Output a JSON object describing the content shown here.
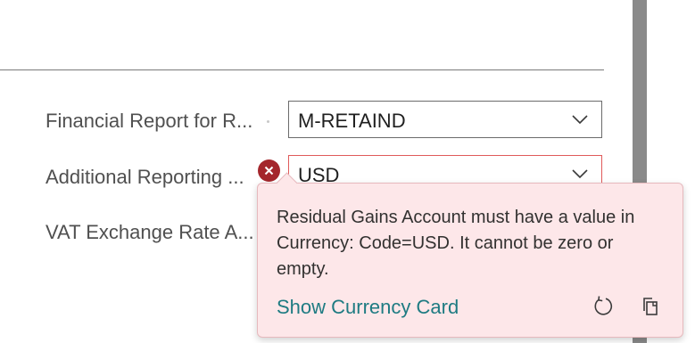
{
  "fields": [
    {
      "label": "Financial Report for R...",
      "value": "M-RETAIND",
      "has_error": false
    },
    {
      "label": "Additional Reporting ...",
      "value": "USD",
      "has_error": true
    },
    {
      "label": "VAT Exchange Rate A...",
      "value": "",
      "has_error": false
    }
  ],
  "error_callout": {
    "message": "Residual Gains Account must have a value in Currency: Code=USD. It cannot be zero or empty.",
    "link_label": "Show Currency Card",
    "actions": [
      "refresh-icon",
      "copy-icon"
    ]
  },
  "colors": {
    "error_icon_bg": "#a4262c",
    "callout_bg": "#fde7e9",
    "link": "#1e7b82",
    "error_border": "#e05a5a"
  }
}
